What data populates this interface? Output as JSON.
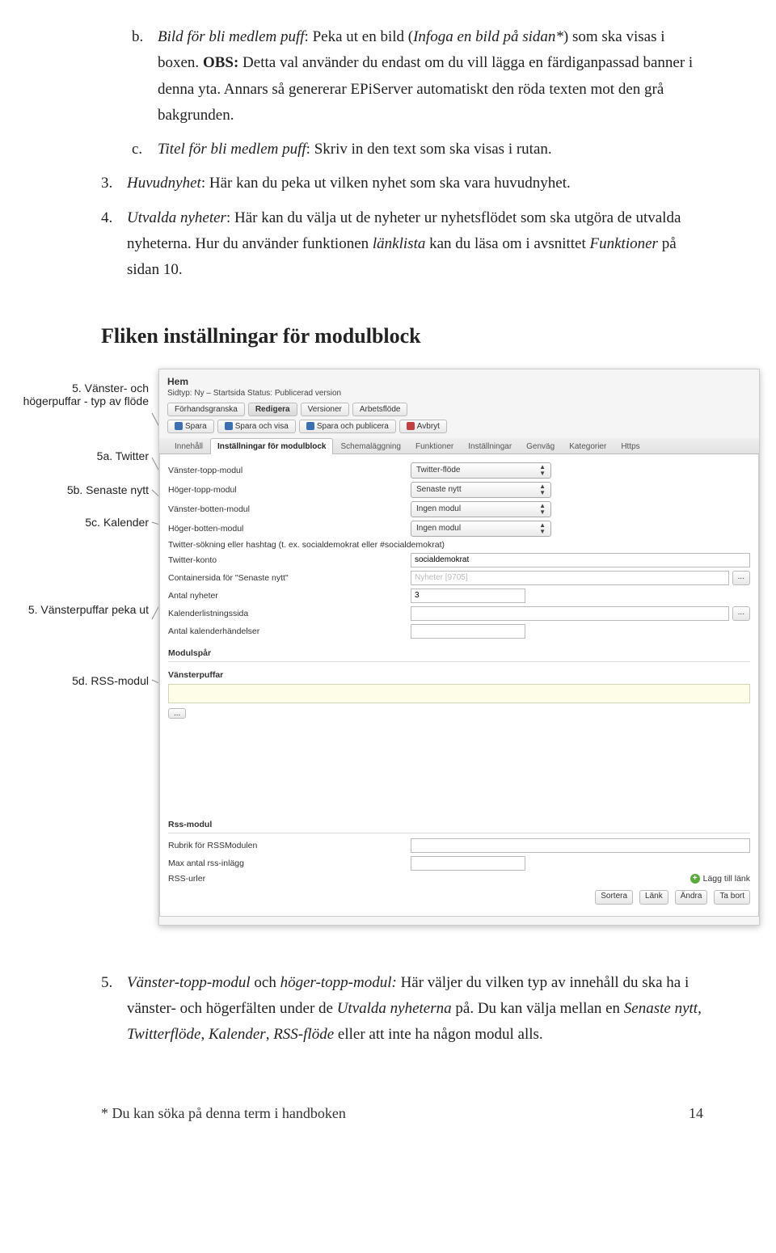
{
  "doc": {
    "item_b": {
      "marker": "b.",
      "text_pre": "Bild för bli medlem puff",
      "text_after_colon1": ": Peka ut en bild (",
      "insert_italic": "Infoga en bild på sidan*",
      "after_paren": ") som ska visas i boxen. ",
      "obs_bold": "OBS:",
      "obs_text": " Detta val använder du endast om du vill lägga en färdiganpassad banner i denna yta. Annars så genererar EPiServer automatiskt den röda texten mot den grå bakgrunden."
    },
    "item_c": {
      "marker": "c.",
      "title_italic": "Titel för bli medlem puff",
      "rest": ": Skriv in den text som ska visas i rutan."
    },
    "item_3": {
      "marker": "3.",
      "title_italic": "Huvudnyhet",
      "rest": ": Här kan du peka ut vilken nyhet som ska vara huvudnyhet."
    },
    "item_4": {
      "marker": "4.",
      "title_italic": "Utvalda nyheter",
      "rest": ": Här kan du välja ut de nyheter ur nyhetsflödet som ska utgöra de utvalda nyheterna. Hur du använder funktionen ",
      "linklist_italic": "länklista",
      "after_linklist": " kan du läsa om i avsnittet ",
      "funktioner_italic": "Funktioner",
      "after_funktioner": " på sidan 10."
    },
    "section_heading": "Fliken inställningar för modulblock",
    "item_5": {
      "marker": "5.",
      "vt_italic": "Vänster-topp-modul",
      "and_text": " och ",
      "ht_italic": "höger-topp-modul:",
      "rest1": " Här väljer du vilken typ av innehåll du ska ha i vänster- och högerfälten under de ",
      "utvalda_italic": "Utvalda nyheterna",
      "rest2": " på. Du kan välja mellan en ",
      "senaste_italic": "Senaste nytt, Twitterflöde",
      "comma1": ", ",
      "kalender_italic": "Kalender",
      "comma2": ", ",
      "rss_italic": "RSS-flöde",
      "rest3": " eller att inte ha någon modul alls."
    },
    "footer_left": "* Du kan söka på denna term i handboken",
    "footer_page": "14"
  },
  "callouts": {
    "c5": "5. Vänster- och högerpuffar - typ av flöde",
    "c5a": "5a. Twitter",
    "c5b": "5b. Senaste nytt",
    "c5c": "5c. Kalender",
    "c5vp": "5. Vänsterpuffar peka ut",
    "c5d": "5d. RSS-modul"
  },
  "editor": {
    "title": "Hem",
    "meta": "Sidtyp: Ny – Startsida   Status: Publicerad version",
    "view_tabs": [
      "Förhandsgranska",
      "Redigera",
      "Versioner",
      "Arbetsflöde"
    ],
    "actions": {
      "save": "Spara",
      "save_show": "Spara och visa",
      "save_publish": "Spara och publicera",
      "cancel": "Avbryt"
    },
    "content_tabs": [
      "Innehåll",
      "Inställningar för modulblock",
      "Schemaläggning",
      "Funktioner",
      "Inställningar",
      "Genväg",
      "Kategorier",
      "Https"
    ],
    "rows": {
      "r1_label": "Vänster-topp-modul",
      "r1_value": "Twitter-flöde",
      "r2_label": "Höger-topp-modul",
      "r2_value": "Senaste nytt",
      "r3_label": "Vänster-botten-modul",
      "r3_value": "Ingen modul",
      "r4_label": "Höger-botten-modul",
      "r4_value": "Ingen modul",
      "r5_label": "Twitter-sökning eller hashtag (t. ex. socialdemokrat eller #socialdemokrat)",
      "r6_label": "Twitter-konto",
      "r6_value": "socialdemokrat",
      "r7_label": "Containersida för \"Senaste nytt\"",
      "r7_value": "Nyheter [9705]",
      "r8_label": "Antal nyheter",
      "r8_value": "3",
      "r9_label": "Kalenderlistningssida",
      "r10_label": "Antal kalenderhändelser",
      "modulspar": "Modulspår",
      "vansterpuffar": "Vänsterpuffar",
      "ellipsis": "...",
      "rss_head": "Rss-modul",
      "rss1": "Rubrik för RSSModulen",
      "rss2": "Max antal rss-inlägg",
      "rss3": "RSS-urler",
      "add_link": "Lägg till länk",
      "btn_sort": "Sortera",
      "btn_link": "Länk",
      "btn_edit": "Ändra",
      "btn_del": "Ta bort"
    }
  }
}
